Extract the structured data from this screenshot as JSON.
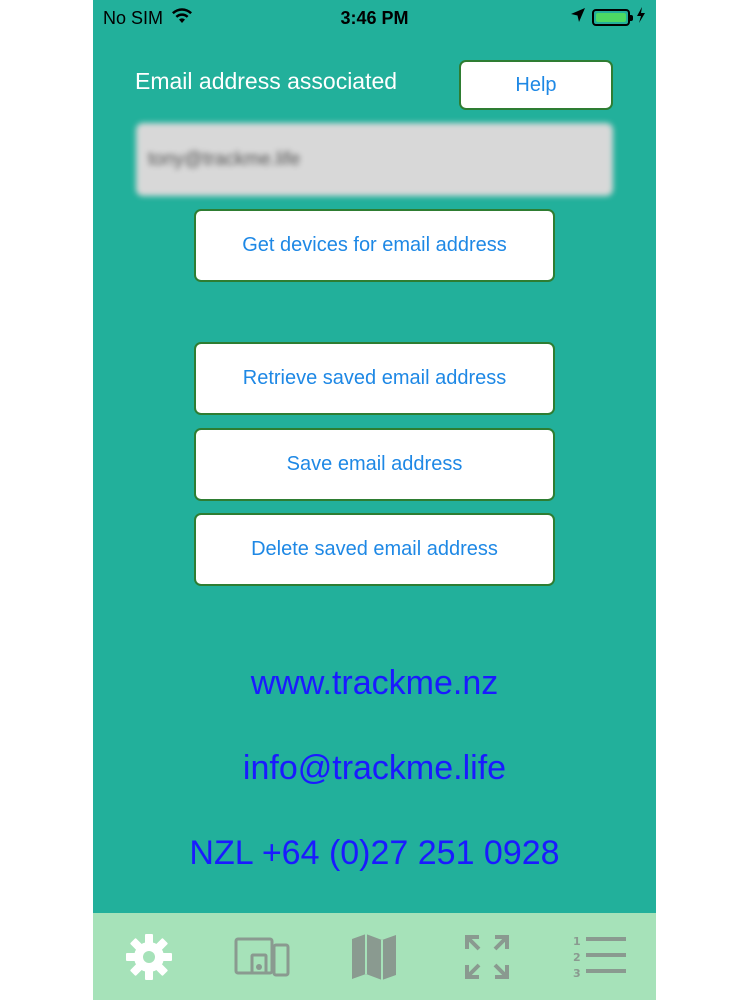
{
  "status_bar": {
    "carrier": "No SIM",
    "time": "3:46 PM"
  },
  "form": {
    "email_label": "Email address associated",
    "help_label": "Help",
    "email_value": "tony@trackme.life",
    "get_devices_label": "Get devices for email address",
    "retrieve_label": "Retrieve saved email address",
    "save_label": "Save email address",
    "delete_label": "Delete saved email address"
  },
  "contact": {
    "website": "www.trackme.nz",
    "email": "info@trackme.life",
    "phone": "NZL +64 (0)27 251 0928"
  },
  "tabs": [
    {
      "icon": "gear-icon",
      "active": true
    },
    {
      "icon": "devices-icon",
      "active": false
    },
    {
      "icon": "map-icon",
      "active": false
    },
    {
      "icon": "expand-icon",
      "active": false
    },
    {
      "icon": "numbered-list-icon",
      "active": false
    }
  ],
  "colors": {
    "background": "#22b09b",
    "tab_bar": "#a6e2b9",
    "button_text": "#1e88e5",
    "contact_text": "#1a1aff",
    "tab_inactive": "#8a9a90",
    "tab_active": "#ffffff"
  }
}
